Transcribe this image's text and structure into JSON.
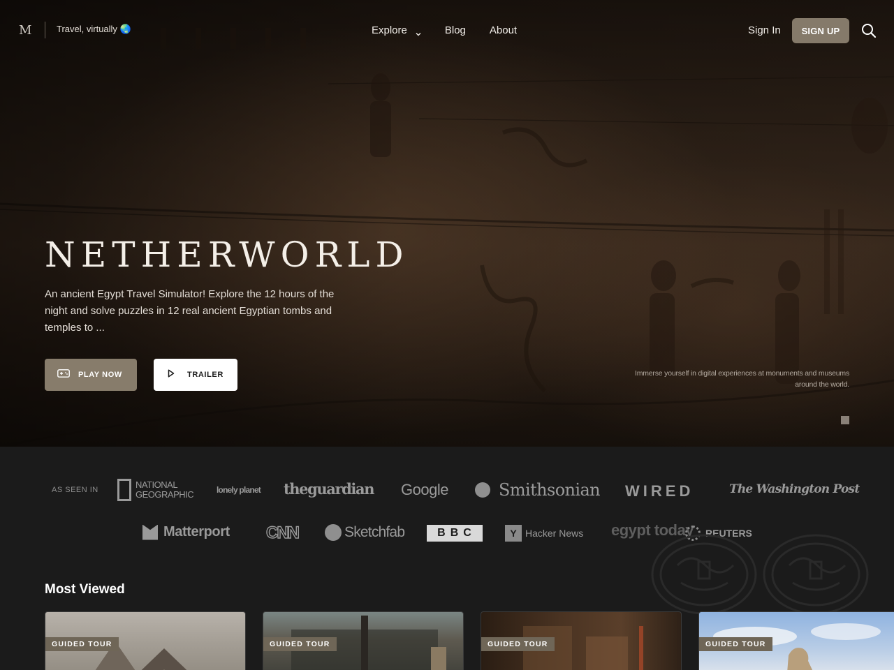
{
  "brand": {
    "logo": "M",
    "tagline": "Travel, virtually 🌏"
  },
  "nav": {
    "items": [
      {
        "label": "Explore",
        "has_dropdown": true
      },
      {
        "label": "Blog"
      },
      {
        "label": "About"
      }
    ],
    "signin_label": "Sign In",
    "signup_label": "SIGN UP"
  },
  "hero": {
    "title": "NETHERWORLD",
    "description": "An ancient Egypt Travel Simulator! Explore the 12 hours of the night and solve puzzles in 12 real ancient Egyptian tombs and temples to ...",
    "play_label": "PLAY NOW",
    "trailer_label": "TRAILER",
    "caption": "Immerse yourself in digital experiences at monuments and museums around the world."
  },
  "press": {
    "label": "AS SEEN IN",
    "logos": [
      "NATIONAL GEOGRAPHIC",
      "lonely planet",
      "theguardian",
      "Google",
      "Smithsonian",
      "WIRED",
      "The Washington Post",
      "Matterport",
      "CNN",
      "Sketchfab",
      "BBC",
      "Hacker News",
      "egypt today",
      "REUTERS"
    ]
  },
  "most_viewed": {
    "title": "Most Viewed",
    "cards": [
      {
        "badge": "GUIDED TOUR"
      },
      {
        "badge": "GUIDED TOUR"
      },
      {
        "badge": "GUIDED TOUR"
      },
      {
        "badge": "GUIDED TOUR"
      }
    ]
  },
  "colors": {
    "accent": "#877c6b",
    "page_bg": "#1b1b1b",
    "badge_bg": "#6f6657"
  },
  "icons": [
    "brand-logo",
    "chevron-down-icon",
    "search-icon",
    "gamepad-icon",
    "play-icon",
    "slide-indicator"
  ]
}
